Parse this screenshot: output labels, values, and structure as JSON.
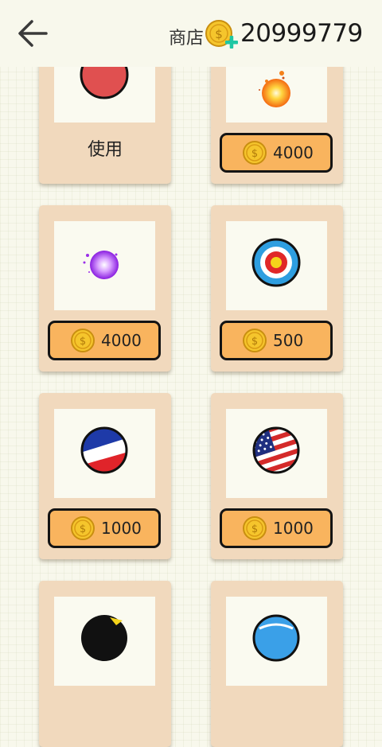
{
  "header": {
    "back_icon": "back-arrow-icon",
    "title": "商店",
    "balance": "20999779",
    "add_coins_icon": "coin-plus-icon"
  },
  "items": [
    {
      "id": "red-ball",
      "icon": "red-ball-icon",
      "action": "use",
      "label": "使用"
    },
    {
      "id": "fireball",
      "icon": "fireball-icon",
      "action": "buy",
      "price": "4000"
    },
    {
      "id": "purple-orb",
      "icon": "purple-orb-icon",
      "action": "buy",
      "price": "4000"
    },
    {
      "id": "target",
      "icon": "target-icon",
      "action": "buy",
      "price": "500"
    },
    {
      "id": "france-flag",
      "icon": "france-flag-ball-icon",
      "action": "buy",
      "price": "1000"
    },
    {
      "id": "usa-flag",
      "icon": "usa-flag-ball-icon",
      "action": "buy",
      "price": "1000"
    },
    {
      "id": "black-ball",
      "icon": "black-ball-icon",
      "action": "buy"
    },
    {
      "id": "blue-ball",
      "icon": "blue-ball-icon",
      "action": "buy"
    }
  ],
  "colors": {
    "card": "#f1d9bd",
    "preview": "#fafaf0",
    "buy_button": "#f9b45e",
    "coin": "#f5c52c",
    "plus": "#1fc7a3"
  }
}
